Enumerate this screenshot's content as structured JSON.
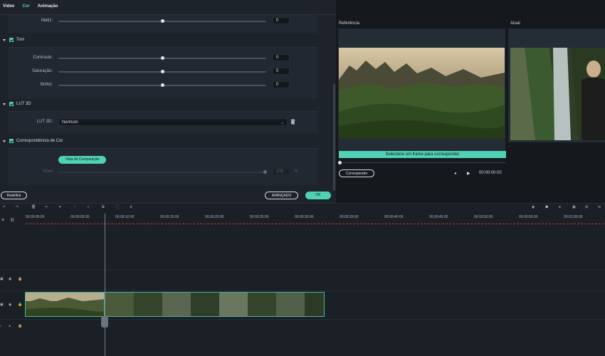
{
  "tabs": [
    "Vídeo",
    "Cor",
    "Animação"
  ],
  "color": {
    "matiz": {
      "label": "Matiz:",
      "value": "0",
      "level": 0.5
    },
    "tom": {
      "section_label": "Tom",
      "contraste": {
        "label": "Contraste:",
        "value": "0",
        "level": 0.5
      },
      "saturacao": {
        "label": "Saturação:",
        "value": "0",
        "level": 0.5
      },
      "brilho": {
        "label": "Brilho:",
        "value": "0",
        "level": 0.5
      }
    },
    "lut": {
      "section_label": "LUT 3D",
      "label": "LUT 3D:",
      "selected": "Nenhum"
    },
    "match": {
      "section_label": "Correspondência de Cor",
      "compare_button": "Vista de Comparação",
      "level_label": "Nível",
      "level_value": "100",
      "level_unit": "%",
      "level": 1.0
    },
    "reset_button": "Redefinir",
    "advanced_button": "AVANÇADO",
    "ok_button": "OK"
  },
  "preview": {
    "reference_label": "Referência",
    "current_label": "Atual",
    "match_banner": "Selecione um frame para corresponder",
    "match_button": "Corresponder",
    "timecode": "00:00:00:00"
  },
  "timeline": {
    "ruler_labels": [
      "00:00:00:00",
      "00:00:05:00",
      "00:00:10:00",
      "00:00:15:00",
      "00:00:20:00",
      "00:00:25:00",
      "00:00:30:00",
      "00:00:35:00",
      "00:00:40:00",
      "00:00:45:00",
      "00:00:50:00",
      "00:00:55:00",
      "00:01:00:00"
    ]
  },
  "colors": {
    "accent": "#4fd1b5",
    "ruler_marker": "#c0392b"
  }
}
